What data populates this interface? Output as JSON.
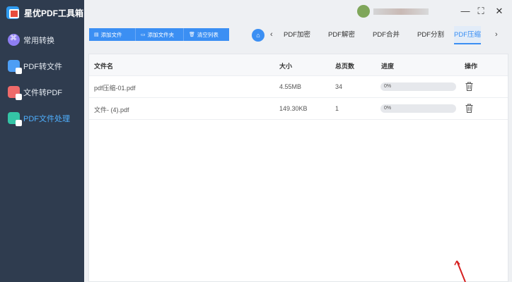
{
  "app": {
    "title": "星优PDF工具箱"
  },
  "sidebar": {
    "items": [
      {
        "label": "常用转换",
        "icon": "common-convert-icon",
        "active": false
      },
      {
        "label": "PDF转文件",
        "icon": "pdf-to-file-icon",
        "active": false
      },
      {
        "label": "文件转PDF",
        "icon": "file-to-pdf-icon",
        "active": false
      },
      {
        "label": "PDF文件处理",
        "icon": "pdf-process-icon",
        "active": true
      }
    ]
  },
  "window": {
    "minimize": "—",
    "maximize": "⛶",
    "close": "✕"
  },
  "toolbar": {
    "add_file": "添加文件",
    "add_folder": "添加文件夹",
    "clear_list": "清空列表"
  },
  "tabs": {
    "items": [
      "PDF加密",
      "PDF解密",
      "PDF合并",
      "PDF分割",
      "PDF压缩"
    ],
    "active": "PDF压缩"
  },
  "table": {
    "headers": {
      "name": "文件名",
      "size": "大小",
      "pages": "总页数",
      "progress": "进度",
      "action": "操作"
    },
    "rows": [
      {
        "name": "pdf压缩-01.pdf",
        "size": "4.55MB",
        "pages": "34",
        "progress": "0%",
        "progress_value": 0
      },
      {
        "name": "文件- (4).pdf",
        "size": "149.30KB",
        "pages": "1",
        "progress": "0%",
        "progress_value": 0
      }
    ]
  },
  "colors": {
    "accent": "#3b8ff3",
    "sidebar_bg": "#2f3c4f",
    "active_nav": "#4fb0ff"
  }
}
